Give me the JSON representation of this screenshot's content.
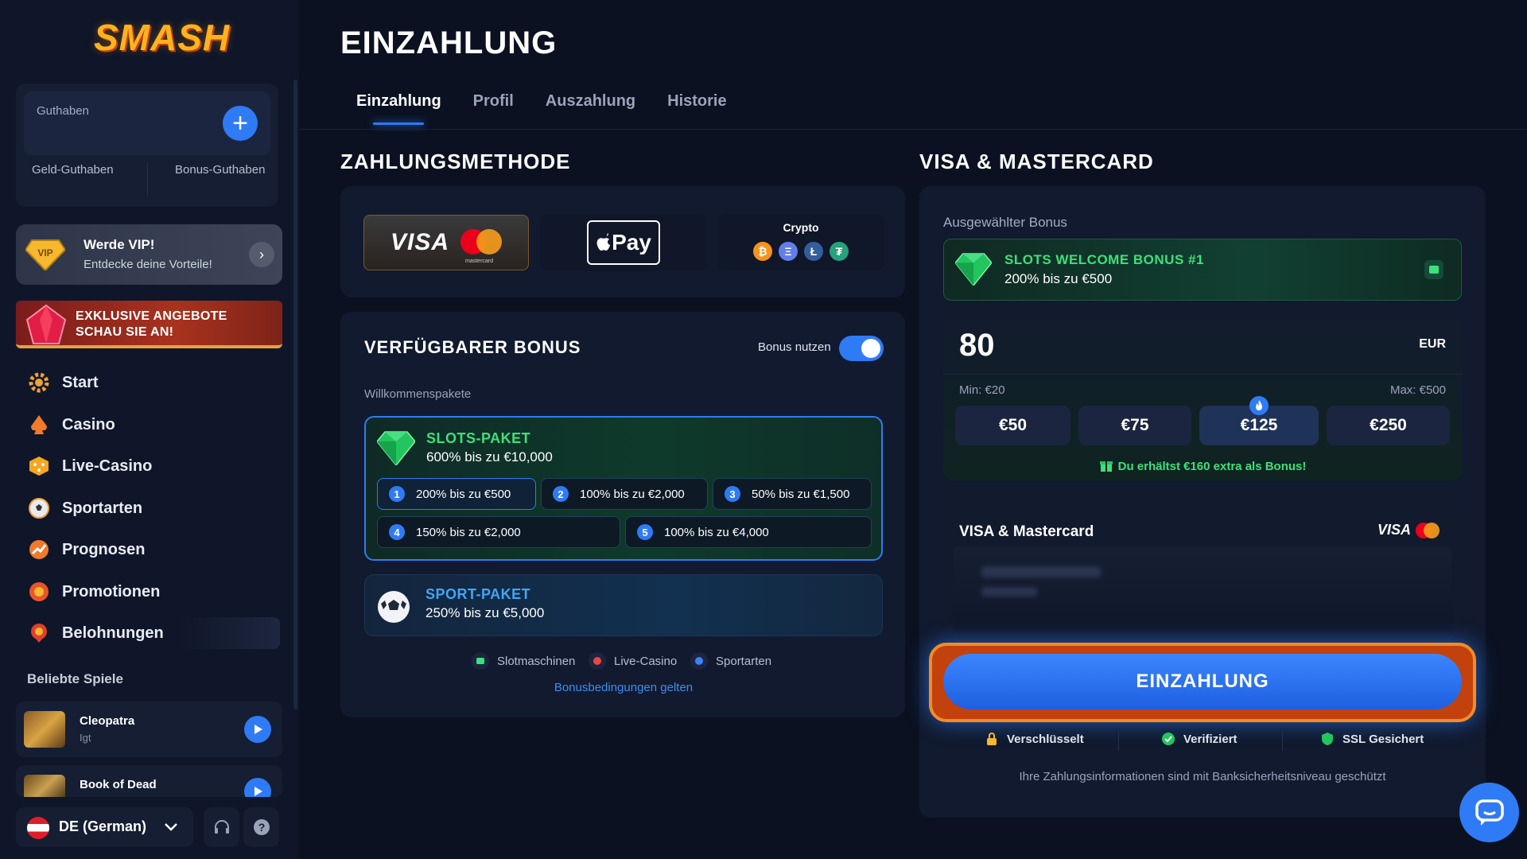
{
  "brand": {
    "logo_text": "SMASH"
  },
  "balance": {
    "label": "Guthaben",
    "cash_label": "Geld-Guthaben",
    "bonus_label": "Bonus-Guthaben"
  },
  "vip": {
    "title": "Werde VIP!",
    "subtitle": "Entdecke deine Vorteile!",
    "badge_text": "VIP"
  },
  "promo_banner": {
    "line1": "EXKLUSIVE ANGEBOTE",
    "line2": "SCHAU SIE AN!"
  },
  "nav": [
    {
      "label": "Start",
      "icon": "gear-icon"
    },
    {
      "label": "Casino",
      "icon": "spade-icon"
    },
    {
      "label": "Live-Casino",
      "icon": "dice-icon"
    },
    {
      "label": "Sportarten",
      "icon": "soccer-ball-icon"
    },
    {
      "label": "Prognosen",
      "icon": "trend-icon"
    },
    {
      "label": "Promotionen",
      "icon": "promo-icon"
    },
    {
      "label": "Belohnungen",
      "icon": "medal-icon"
    }
  ],
  "popular": {
    "title": "Beliebte Spiele",
    "games": [
      {
        "name": "Cleopatra",
        "provider": "Igt"
      },
      {
        "name": "Book of Dead",
        "provider": ""
      }
    ]
  },
  "language": {
    "label": "DE (German)"
  },
  "page": {
    "title": "EINZAHLUNG"
  },
  "tabs": [
    {
      "label": "Einzahlung",
      "active": true
    },
    {
      "label": "Profil",
      "active": false
    },
    {
      "label": "Auszahlung",
      "active": false
    },
    {
      "label": "Historie",
      "active": false
    }
  ],
  "payment_methods": {
    "title": "ZAHLUNGSMETHODE",
    "visa": "VISA",
    "mastercard": "mastercard",
    "applepay": "Pay",
    "crypto": "Crypto",
    "crypto_coins": [
      "₿",
      "Ξ",
      "Ł",
      "₮"
    ]
  },
  "available_bonus": {
    "title": "VERFÜGBARER BONUS",
    "toggle_label": "Bonus nutzen",
    "toggle_on": true,
    "group_label": "Willkommenspakete",
    "slots": {
      "title": "SLOTS-PAKET",
      "subtitle": "600% bis zu €10,000",
      "tiers": [
        {
          "num": "1",
          "text": "200% bis zu €500"
        },
        {
          "num": "2",
          "text": "100% bis zu €2,000"
        },
        {
          "num": "3",
          "text": "50% bis zu €1,500"
        },
        {
          "num": "4",
          "text": "150% bis zu €2,000"
        },
        {
          "num": "5",
          "text": "100% bis zu €4,000"
        }
      ]
    },
    "sport": {
      "title": "SPORT-PAKET",
      "subtitle": "250% bis zu €5,000"
    },
    "categories": [
      "Slotmaschinen",
      "Live-Casino",
      "Sportarten"
    ],
    "terms_link": "Bonusbedingungen gelten"
  },
  "visa_panel": {
    "title": "VISA & MASTERCARD",
    "selected_label": "Ausgewählter Bonus",
    "selected_title": "SLOTS WELCOME BONUS #1",
    "selected_sub": "200% bis zu €500",
    "amount": "80",
    "currency": "EUR",
    "min": "Min: €20",
    "max": "Max: €500",
    "presets": [
      "€50",
      "€75",
      "€125",
      "€250"
    ],
    "extra_note": "Du erhältst €160 extra als Bonus!",
    "card_title": "VISA & Mastercard",
    "card_visa": "VISA",
    "deposit_button": "EINZAHLUNG",
    "trust": [
      "Verschlüsselt",
      "Verifiziert",
      "SSL Gesichert"
    ],
    "secure_note": "Ihre Zahlungsinformationen sind mit Banksicherheitsniveau geschützt"
  },
  "colors": {
    "accent": "#2f7bf5",
    "green": "#3ee07a",
    "orange": "#f28c28",
    "bg": "#0b1121"
  }
}
